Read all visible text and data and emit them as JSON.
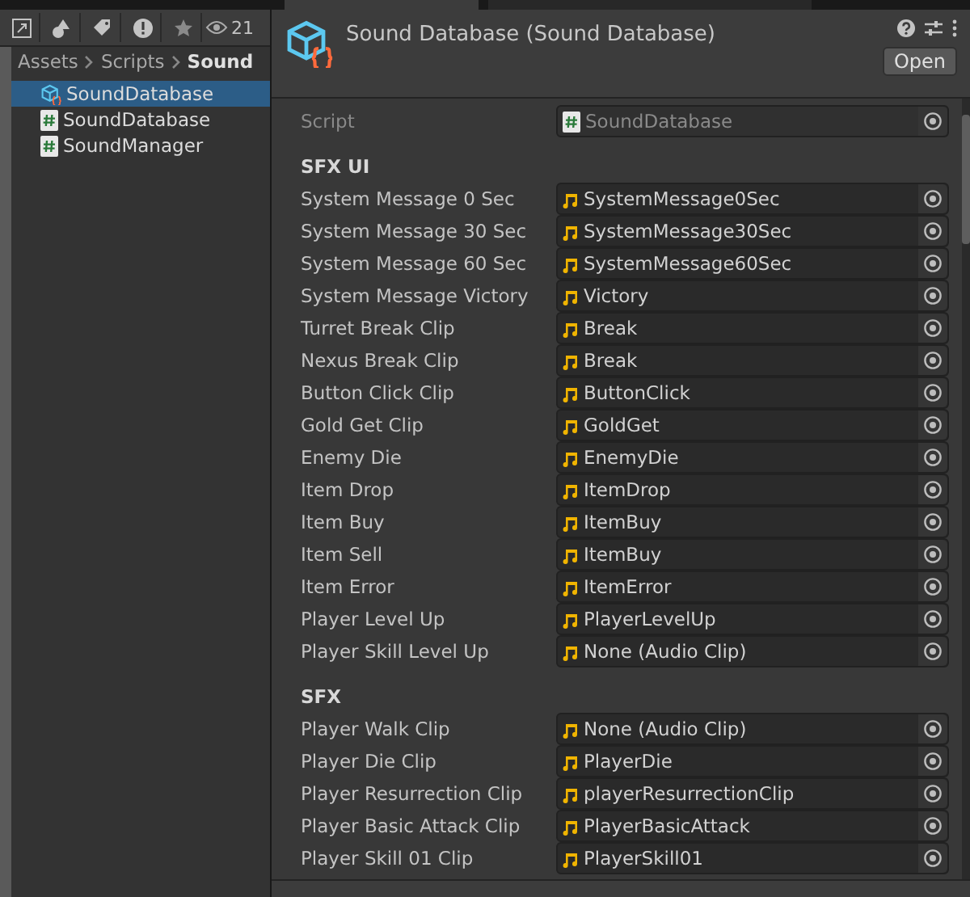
{
  "project": {
    "toolbar_count": "21",
    "breadcrumb": [
      {
        "label": "Assets",
        "current": false
      },
      {
        "label": "Scripts",
        "current": false
      },
      {
        "label": "Sound",
        "current": true
      }
    ],
    "items": [
      {
        "label": "SoundDatabase",
        "kind": "asset",
        "selected": true
      },
      {
        "label": "SoundDatabase",
        "kind": "script",
        "selected": false
      },
      {
        "label": "SoundManager",
        "kind": "script",
        "selected": false
      }
    ]
  },
  "inspector": {
    "title": "Sound Database (Sound Database)",
    "open_button": "Open",
    "script": {
      "label": "Script",
      "value": "SoundDatabase"
    },
    "sections": [
      {
        "header": "SFX UI",
        "fields": [
          {
            "label": "System Message 0 Sec",
            "value": "SystemMessage0Sec"
          },
          {
            "label": "System Message 30 Sec",
            "value": "SystemMessage30Sec"
          },
          {
            "label": "System Message 60 Sec",
            "value": "SystemMessage60Sec"
          },
          {
            "label": "System Message Victory",
            "value": "Victory"
          },
          {
            "label": "Turret Break Clip",
            "value": "Break"
          },
          {
            "label": "Nexus Break Clip",
            "value": "Break"
          },
          {
            "label": "Button Click Clip",
            "value": "ButtonClick"
          },
          {
            "label": "Gold Get Clip",
            "value": "GoldGet"
          },
          {
            "label": "Enemy Die",
            "value": "EnemyDie"
          },
          {
            "label": "Item Drop",
            "value": "ItemDrop"
          },
          {
            "label": "Item Buy",
            "value": "ItemBuy"
          },
          {
            "label": "Item Sell",
            "value": "ItemBuy"
          },
          {
            "label": "Item Error",
            "value": "ItemError"
          },
          {
            "label": "Player Level Up",
            "value": "PlayerLevelUp"
          },
          {
            "label": "Player Skill Level Up",
            "value": "None (Audio Clip)"
          }
        ]
      },
      {
        "header": "SFX",
        "fields": [
          {
            "label": "Player Walk Clip",
            "value": "None (Audio Clip)"
          },
          {
            "label": "Player Die Clip",
            "value": "PlayerDie"
          },
          {
            "label": "Player Resurrection Clip",
            "value": "playerResurrectionClip"
          },
          {
            "label": "Player Basic Attack Clip",
            "value": "PlayerBasicAttack"
          },
          {
            "label": "Player Skill 01 Clip",
            "value": "PlayerSkill01"
          }
        ]
      }
    ]
  }
}
